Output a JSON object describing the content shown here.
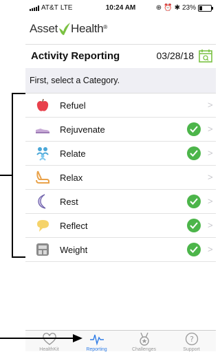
{
  "status": {
    "carrier": "AT&T",
    "network": "LTE",
    "time": "10:24 AM",
    "battery": "23%",
    "battery_level": 0.23
  },
  "brand": {
    "part1": "Asset",
    "part2": "Health",
    "tm": "®"
  },
  "header": {
    "title": "Activity Reporting",
    "date": "03/28/18"
  },
  "prompt": "First, select a Category.",
  "categories": [
    {
      "label": "Refuel",
      "icon": "apple-icon",
      "checked": false
    },
    {
      "label": "Rejuvenate",
      "icon": "shoe-icon",
      "checked": true
    },
    {
      "label": "Relate",
      "icon": "people-icon",
      "checked": true
    },
    {
      "label": "Relax",
      "icon": "chair-icon",
      "checked": false
    },
    {
      "label": "Rest",
      "icon": "moon-icon",
      "checked": true
    },
    {
      "label": "Reflect",
      "icon": "speech-bubble-icon",
      "checked": true
    },
    {
      "label": "Weight",
      "icon": "scale-icon",
      "checked": true
    }
  ],
  "tabs": [
    {
      "label": "HealthKit",
      "icon": "heart-icon",
      "active": false
    },
    {
      "label": "Reporting",
      "icon": "pulse-icon",
      "active": true
    },
    {
      "label": "Challenges",
      "icon": "medal-icon",
      "active": false
    },
    {
      "label": "Support",
      "icon": "help-icon",
      "active": false
    }
  ],
  "colors": {
    "check": "#4cb54a",
    "active_tab": "#2f7ce6",
    "logo_green": "#7ac142"
  }
}
